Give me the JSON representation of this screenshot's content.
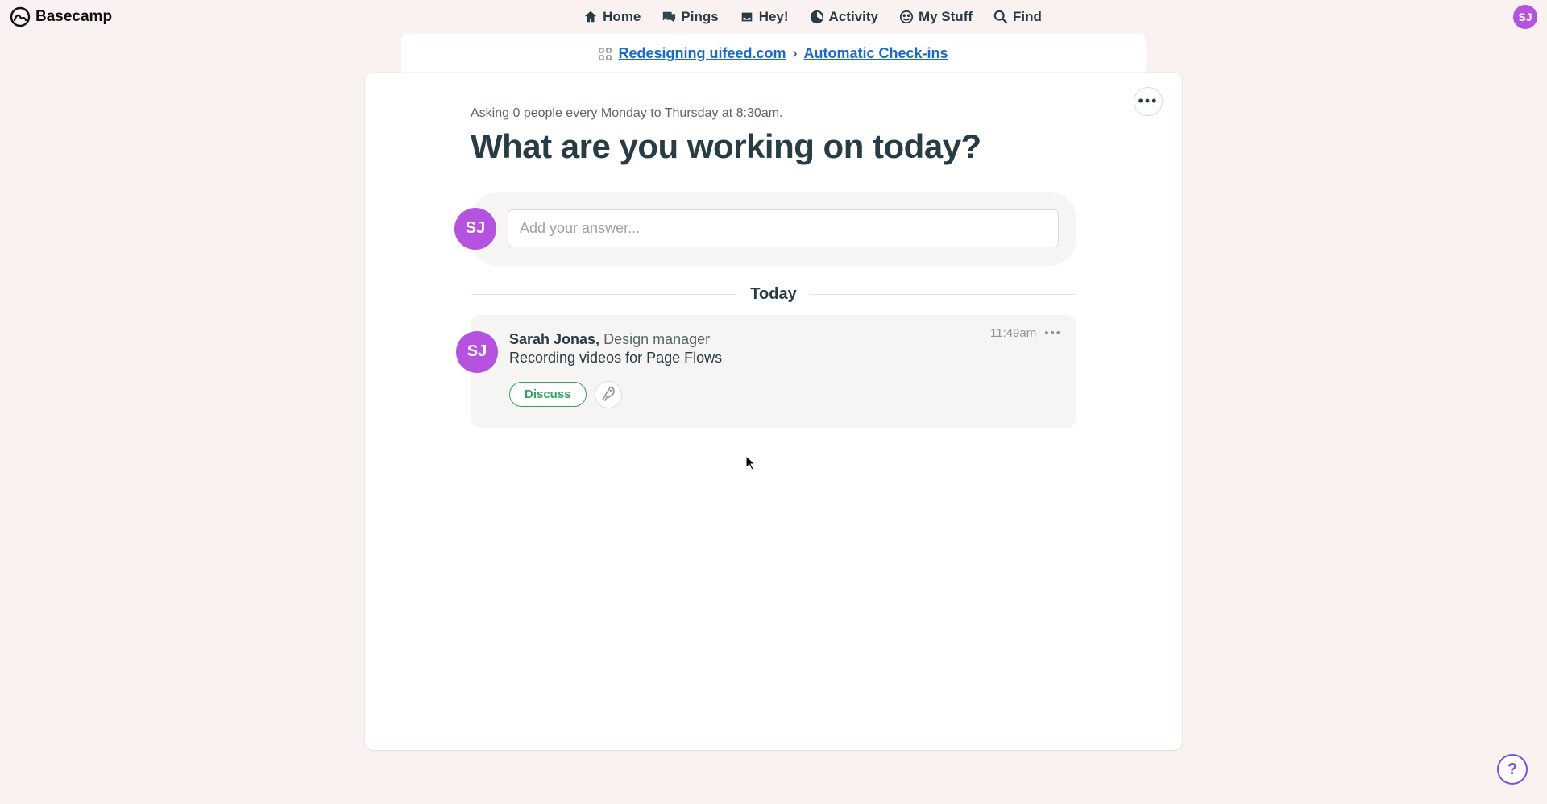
{
  "brand": "Basecamp",
  "nav": {
    "home": "Home",
    "pings": "Pings",
    "hey": "Hey!",
    "activity": "Activity",
    "mystuff": "My Stuff",
    "find": "Find"
  },
  "user": {
    "initials": "SJ"
  },
  "breadcrumb": {
    "project": "Redesigning uifeed.com",
    "section": "Automatic Check-ins",
    "separator": "›"
  },
  "checkin": {
    "schedule": "Asking 0 people every Monday to Thursday at 8:30am.",
    "question": "What are you working on today?",
    "answer_placeholder": "Add your answer...",
    "divider": "Today"
  },
  "entry": {
    "avatar": "SJ",
    "name": "Sarah Jonas,",
    "role": "Design manager",
    "text": "Recording videos for Page Flows",
    "time": "11:49am",
    "discuss": "Discuss"
  },
  "help": "?"
}
